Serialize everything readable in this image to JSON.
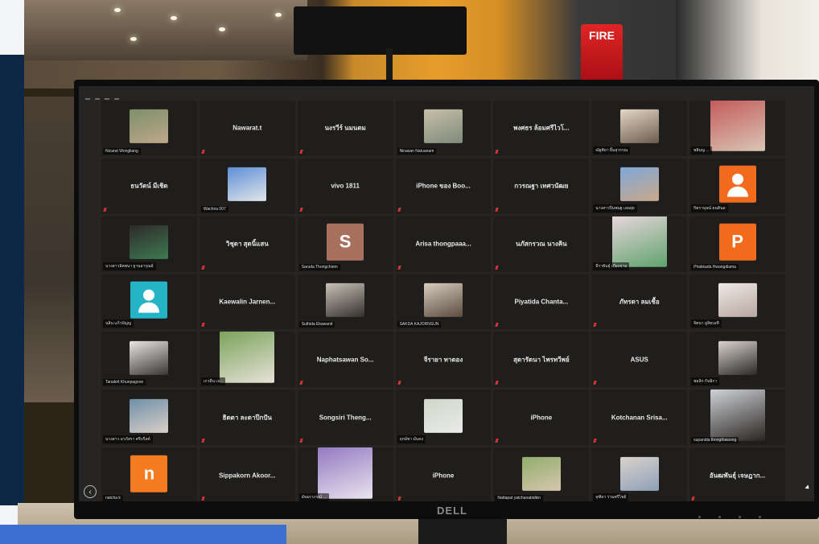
{
  "scene": {
    "fire_sign": "FIRE",
    "monitor_brand": "DELL"
  },
  "grid": {
    "rows": [
      [
        {
          "kind": "photo",
          "label": "Nicarat Wongliang",
          "colors": [
            "#7c8f6a",
            "#bfa88a"
          ]
        },
        {
          "kind": "name",
          "name": "Nawarat.t"
        },
        {
          "kind": "name",
          "name": "นงรวีร์ นมนตม"
        },
        {
          "kind": "photo",
          "label": "Nirawan Natuanam",
          "colors": [
            "#c8c0a8",
            "#7d8a7b"
          ]
        },
        {
          "kind": "name",
          "name": "พงศธร ล้อมศรีไวโ..."
        },
        {
          "kind": "photo",
          "label": "ณัฐติยา ยิ้มสุวรรณ",
          "colors": [
            "#e3d7c7",
            "#6d5c4e"
          ]
        },
        {
          "kind": "photo",
          "label": "พลิมญ ...",
          "colors": [
            "#c45a5a",
            "#d9c5b5"
          ],
          "size": "large"
        }
      ],
      [
        {
          "kind": "name",
          "name": "ธนวัตน์ มีเชิด"
        },
        {
          "kind": "photo",
          "label": "Wachira 007",
          "colors": [
            "#5d8ed6",
            "#e2e6ea"
          ]
        },
        {
          "kind": "name",
          "name": "vivo 1811"
        },
        {
          "kind": "name",
          "name": "iPhone ของ Boo..."
        },
        {
          "kind": "name",
          "name": "กวรณฐา เทศวนัฒย"
        },
        {
          "kind": "photo",
          "label": "นางสาวปิ่นพนฐ เลยอุ่ย",
          "colors": [
            "#7fa8d8",
            "#caa88a"
          ]
        },
        {
          "kind": "avatar",
          "letter": "",
          "label": "กิตรานุษน์ ยนคินล",
          "color": "#f26a1b"
        }
      ],
      [
        {
          "kind": "photo",
          "label": "นางสาวอิตพนา ฐานอารุณย์",
          "colors": [
            "#2e2a28",
            "#3e7a52"
          ]
        },
        {
          "kind": "name",
          "name": "วิชุดา สุดนิ้แสน"
        },
        {
          "kind": "avatar",
          "letter": "S",
          "label": "Saruda Thongchiem",
          "color": "#a7715e"
        },
        {
          "kind": "name",
          "name": "Arisa thongpaaa..."
        },
        {
          "kind": "name",
          "name": "นภัสกรวณ นางคิน"
        },
        {
          "kind": "photo",
          "label": "ธีราพันธุ์ เกียงชาย",
          "colors": [
            "#e9d6dc",
            "#5fa36c"
          ],
          "size": "large"
        },
        {
          "kind": "avatar",
          "letter": "P",
          "label": "Phakkada Hwangdiama",
          "color": "#f26a1b"
        }
      ],
      [
        {
          "kind": "avatar",
          "letter": "",
          "label": "นลิน แก้วบัญญ",
          "color": "#25b3c8"
        },
        {
          "kind": "name",
          "name": "Kaewalin Jarnen..."
        },
        {
          "kind": "photo",
          "label": "Suthida Ekawanit",
          "colors": [
            "#c9c2b8",
            "#34302d"
          ]
        },
        {
          "kind": "photo",
          "label": "SAKDA KAJORNSUN",
          "colors": [
            "#d7cdbf",
            "#5a4b3e"
          ]
        },
        {
          "kind": "name",
          "name": "Piyatida Chanta..."
        },
        {
          "kind": "name",
          "name": "ภัทรดา ลมเชื้อ"
        },
        {
          "kind": "photo",
          "label": "จิตนา ลูลิทเมที",
          "colors": [
            "#efe9e4",
            "#b7a6a0"
          ]
        }
      ],
      [
        {
          "kind": "photo",
          "label": "Tanakrit Khunpagoon",
          "colors": [
            "#e8e6e4",
            "#3a3634"
          ]
        },
        {
          "kind": "photo",
          "label": "เกวลีน เจ...",
          "colors": [
            "#7aa35a",
            "#e7e2d8"
          ],
          "size": "large"
        },
        {
          "kind": "name",
          "name": "Naphatsawan So..."
        },
        {
          "kind": "name",
          "name": "จีรายา ทาดอง"
        },
        {
          "kind": "name",
          "name": "สุดารัตนา ไพรทวีพย์"
        },
        {
          "kind": "name",
          "name": "ASUS"
        },
        {
          "kind": "photo",
          "label": "พอลิก กันธิกา",
          "colors": [
            "#d9d4cf",
            "#2c2826"
          ]
        }
      ],
      [
        {
          "kind": "photo",
          "label": "นางสาว อาภัสรา ศรีบรีลด์",
          "colors": [
            "#6f8fa8",
            "#d9d0c8"
          ]
        },
        {
          "kind": "name",
          "name": "ธิดดา ละดาปีกปัน"
        },
        {
          "kind": "name",
          "name": "Songsiri Theng..."
        },
        {
          "kind": "photo",
          "label": "ฤกษ์ชา มั่นคง",
          "colors": [
            "#cfd8c8",
            "#eaeaea"
          ]
        },
        {
          "kind": "name",
          "name": "iPhone"
        },
        {
          "kind": "name",
          "name": "Kotchanan Srisa..."
        },
        {
          "kind": "photo",
          "label": "supanida thongthawong",
          "colors": [
            "#cfd3d8",
            "#2b2522"
          ],
          "size": "large"
        }
      ],
      [
        {
          "kind": "avatar",
          "letter": "n",
          "label": "natcha k",
          "color": "#f47b20"
        },
        {
          "kind": "name",
          "name": "Sippakorn Akoor..."
        },
        {
          "kind": "photo",
          "label": "อัจฉราภรณ์ ...",
          "colors": [
            "#9478c2",
            "#e9e4ee"
          ],
          "size": "large"
        },
        {
          "kind": "name",
          "name": "iPhone"
        },
        {
          "kind": "photo",
          "label": "Nattapat yatchanabidkin",
          "colors": [
            "#8fae6a",
            "#d8c6b0"
          ]
        },
        {
          "kind": "photo",
          "label": "จุฑิดา ร่วมศรีไชย์",
          "colors": [
            "#d8d2cc",
            "#8fa0b8"
          ]
        },
        {
          "kind": "name",
          "name": "อันฒพันธุ์ เจษฎาก..."
        }
      ]
    ]
  }
}
